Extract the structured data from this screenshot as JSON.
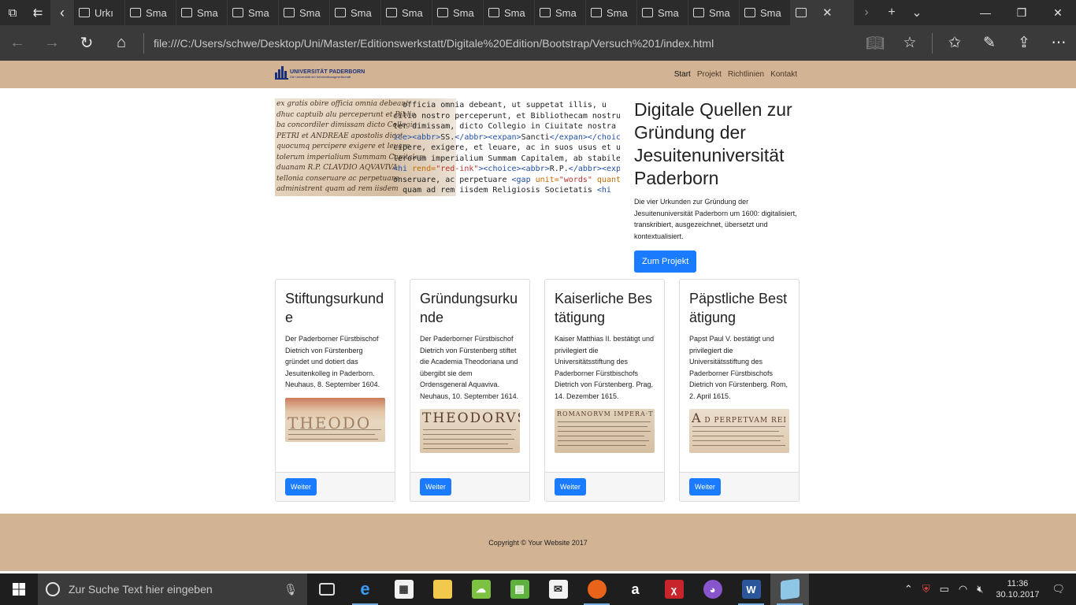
{
  "browser": {
    "tabs": [
      {
        "label": "Urkı"
      },
      {
        "label": "Sma"
      },
      {
        "label": "Sma"
      },
      {
        "label": "Sma"
      },
      {
        "label": "Sma"
      },
      {
        "label": "Sma"
      },
      {
        "label": "Sma"
      },
      {
        "label": "Sma"
      },
      {
        "label": "Sma"
      },
      {
        "label": "Sma"
      },
      {
        "label": "Sma"
      },
      {
        "label": "Sma"
      },
      {
        "label": "Sma"
      },
      {
        "label": "Sma"
      }
    ],
    "address_url": "file:///C:/Users/schwe/Desktop/Uni/Master/Editionswerkstatt/Digitale%20Edition/Bootstrap/Versuch%201/index.html"
  },
  "site": {
    "logo_title": "UNIVERSITÄT PADERBORN",
    "logo_subtitle": "Die Universität der Informationsgesellschaft",
    "nav": {
      "start": "Start",
      "projekt": "Projekt",
      "richtlinien": "Richtlinien",
      "kontakt": "Kontakt"
    },
    "hero": {
      "title": "Digitale Quellen zur Gründung der Jesuitenuniversität Paderborn",
      "description": "Die vier Urkunden zur Gründung der Jesuitenuniversität Paderborn um 1600: digitalisiert, transkribiert, ausgezeichnet, übersetzt und kontextualisiert.",
      "button": "Zum Projekt"
    },
    "cards": [
      {
        "title": "Stiftungsurkunde",
        "text": "Der Paderborner Fürstbischof Dietrich von Fürstenberg gründet und dotiert das Jesuitenkolleg in Paderborn. Neuhaus, 8. September 1604.",
        "button": "Weiter"
      },
      {
        "title": "Gründungsurkunde",
        "text": "Der Paderborner Fürstbischof Dietrich von Fürstenberg stiftet die Academia Theodoriana und übergibt sie dem Ordensgeneral Aquaviva. Neuhaus, 10. September 1614.",
        "button": "Weiter"
      },
      {
        "title": "Kaiserliche Bestätigung",
        "text": "Kaiser Matthias II. bestätigt und privilegiert die Universitätsstiftung des Paderborner Fürstbischofs Dietrich von Fürstenberg. Prag, 14. Dezember 1615.",
        "button": "Weiter"
      },
      {
        "title": "Päpstliche Bestätigung",
        "text": "Papst Paul V. bestätigt und privilegiert die Universitätsstiftung des Paderborner Fürstbischofs Dietrich von Fürstenberg. Rom, 2. April 1615.",
        "button": "Weiter"
      }
    ],
    "footer": "Copyright © Your Website 2017"
  },
  "taskbar": {
    "search_placeholder": "Zur Suche Text hier eingeben",
    "time": "11:36",
    "date": "30.10.2017"
  }
}
